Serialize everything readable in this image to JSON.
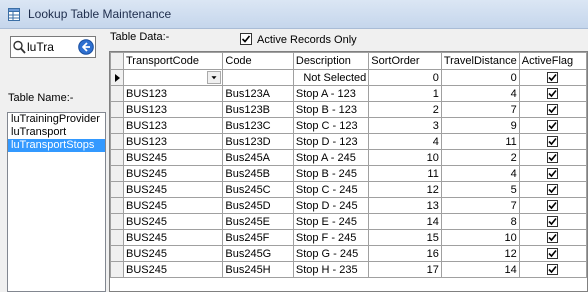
{
  "window": {
    "title": "Lookup Table Maintenance"
  },
  "search": {
    "value": "luTra"
  },
  "table_name": {
    "label": "Table Name:-",
    "items": [
      {
        "label": "luTrainingProvider",
        "selected": false
      },
      {
        "label": "luTransport",
        "selected": false
      },
      {
        "label": "luTransportStops",
        "selected": true
      }
    ]
  },
  "table_data": {
    "label": "Table Data:-",
    "active_only": {
      "label": "Active Records Only",
      "checked": true
    },
    "columns": [
      "TransportCode",
      "Code",
      "Description",
      "SortOrder",
      "TravelDistance",
      "ActiveFlag"
    ],
    "new_row": {
      "transport_code": "",
      "code": "",
      "description": "Not Selected",
      "sort_order": "0",
      "travel_distance": "0",
      "active": true
    },
    "rows": [
      {
        "transport_code": "BUS123",
        "code": "Bus123A",
        "description": "Stop A - 123",
        "sort_order": "1",
        "travel_distance": "4",
        "active": true
      },
      {
        "transport_code": "BUS123",
        "code": "Bus123B",
        "description": "Stop B - 123",
        "sort_order": "2",
        "travel_distance": "7",
        "active": true
      },
      {
        "transport_code": "BUS123",
        "code": "Bus123C",
        "description": "Stop C - 123",
        "sort_order": "3",
        "travel_distance": "9",
        "active": true
      },
      {
        "transport_code": "BUS123",
        "code": "Bus123D",
        "description": "Stop D - 123",
        "sort_order": "4",
        "travel_distance": "11",
        "active": true
      },
      {
        "transport_code": "BUS245",
        "code": "Bus245A",
        "description": "Stop A - 245",
        "sort_order": "10",
        "travel_distance": "2",
        "active": true
      },
      {
        "transport_code": "BUS245",
        "code": "Bus245B",
        "description": "Stop B - 245",
        "sort_order": "11",
        "travel_distance": "4",
        "active": true
      },
      {
        "transport_code": "BUS245",
        "code": "Bus245C",
        "description": "Stop C - 245",
        "sort_order": "12",
        "travel_distance": "5",
        "active": true
      },
      {
        "transport_code": "BUS245",
        "code": "Bus245D",
        "description": "Stop D - 245",
        "sort_order": "13",
        "travel_distance": "7",
        "active": true
      },
      {
        "transport_code": "BUS245",
        "code": "Bus245E",
        "description": "Stop E - 245",
        "sort_order": "14",
        "travel_distance": "8",
        "active": true
      },
      {
        "transport_code": "BUS245",
        "code": "Bus245F",
        "description": "Stop F - 245",
        "sort_order": "15",
        "travel_distance": "10",
        "active": true
      },
      {
        "transport_code": "BUS245",
        "code": "Bus245G",
        "description": "Stop G - 245",
        "sort_order": "16",
        "travel_distance": "12",
        "active": true
      },
      {
        "transport_code": "BUS245",
        "code": "Bus245H",
        "description": "Stop H - 235",
        "sort_order": "17",
        "travel_distance": "14",
        "active": true
      }
    ]
  },
  "icons": {
    "app": "table-icon",
    "search": "magnifier-icon",
    "go": "go-arrow-icon",
    "row_marker": "current-row-arrow-icon"
  },
  "colors": {
    "selection": "#3399ff",
    "go_button": "#2d6fd0",
    "titlebar": "#c5d6ec"
  }
}
